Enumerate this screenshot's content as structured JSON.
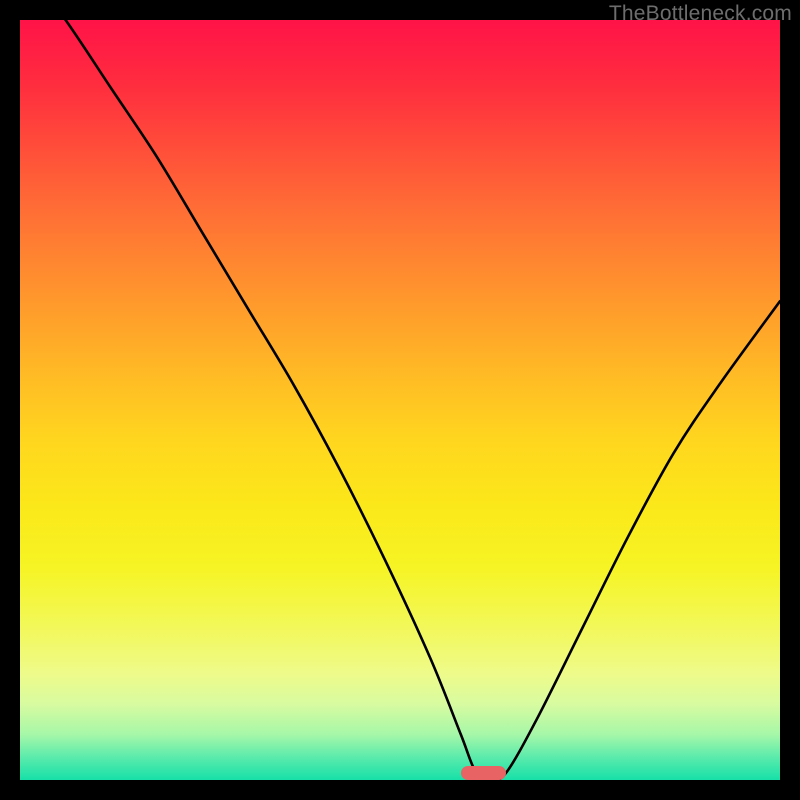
{
  "watermark": "TheBottleneck.com",
  "chart_data": {
    "type": "line",
    "title": "",
    "xlabel": "",
    "ylabel": "",
    "xlim": [
      0,
      100
    ],
    "ylim": [
      0,
      100
    ],
    "grid": false,
    "series": [
      {
        "name": "bottleneck-curve",
        "x": [
          0,
          6,
          12,
          18,
          24,
          30,
          36,
          42,
          48,
          54,
          58,
          60,
          62,
          64,
          68,
          74,
          80,
          86,
          92,
          100
        ],
        "values": [
          108,
          100,
          91,
          82,
          72,
          62,
          52,
          41,
          29,
          16,
          6,
          1,
          0,
          1,
          8,
          20,
          32,
          43,
          52,
          63
        ]
      }
    ],
    "marker": {
      "x": 61,
      "width_pct": 6
    },
    "gradient": {
      "top_color": "#ff1348",
      "bottom_color": "#16e0a8"
    }
  }
}
